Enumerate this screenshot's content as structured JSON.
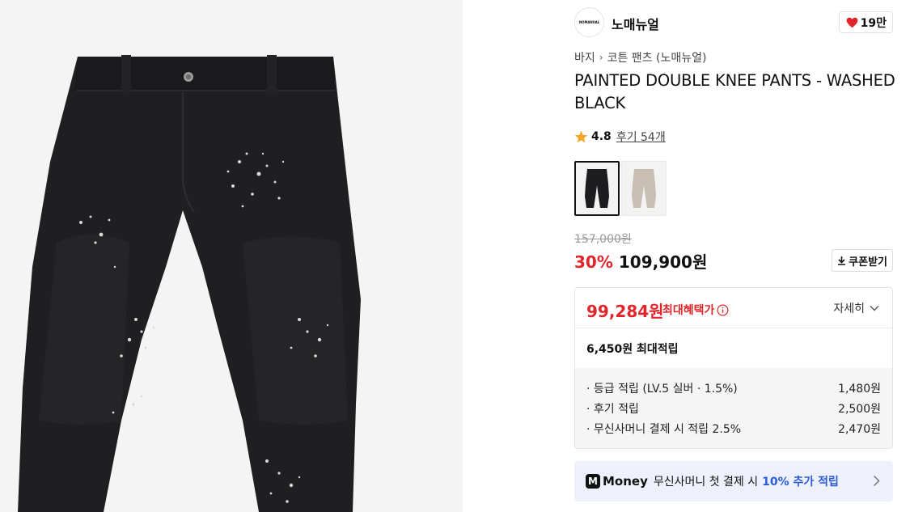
{
  "brand": {
    "logo_text": "NOMANUAL",
    "name": "노매뉴얼"
  },
  "like": {
    "count": "19만",
    "icon": "heart-icon",
    "color": "#e0262b"
  },
  "breadcrumb": {
    "items": [
      "바지",
      "코튼 팬츠 (노매뉴얼)"
    ]
  },
  "product": {
    "title": "PAINTED DOUBLE KNEE PANTS - WASHED BLACK",
    "rating": "4.8",
    "reviews": "후기 54개",
    "swatches": [
      {
        "name": "black",
        "color": "#1d1d1f",
        "selected": true
      },
      {
        "name": "beige",
        "color": "#c8bfb2",
        "selected": false
      }
    ]
  },
  "price": {
    "original": "157,000원",
    "discount": "30%",
    "sale": "109,900원",
    "coupon_label": "쿠폰받기",
    "accent_color": "#e0262b"
  },
  "benefit": {
    "best_price": "99,284원",
    "best_label": "최대혜택가",
    "detail_label": "자세히",
    "points_title": "6,450원 최대적립",
    "points": [
      {
        "label": "· 등급 적립 (LV.5 실버 · 1.5%)",
        "value": "1,480원"
      },
      {
        "label": "· 후기 적립",
        "value": "2,500원"
      },
      {
        "label": "· 무신사머니 결제 시 적립 2.5%",
        "value": "2,470원"
      }
    ]
  },
  "money_banner": {
    "logo": "M",
    "brand": "Money",
    "text": "무신사머니 첫 결제 시",
    "highlight": "10% 추가 적립",
    "highlight_color": "#2a5bd7"
  }
}
